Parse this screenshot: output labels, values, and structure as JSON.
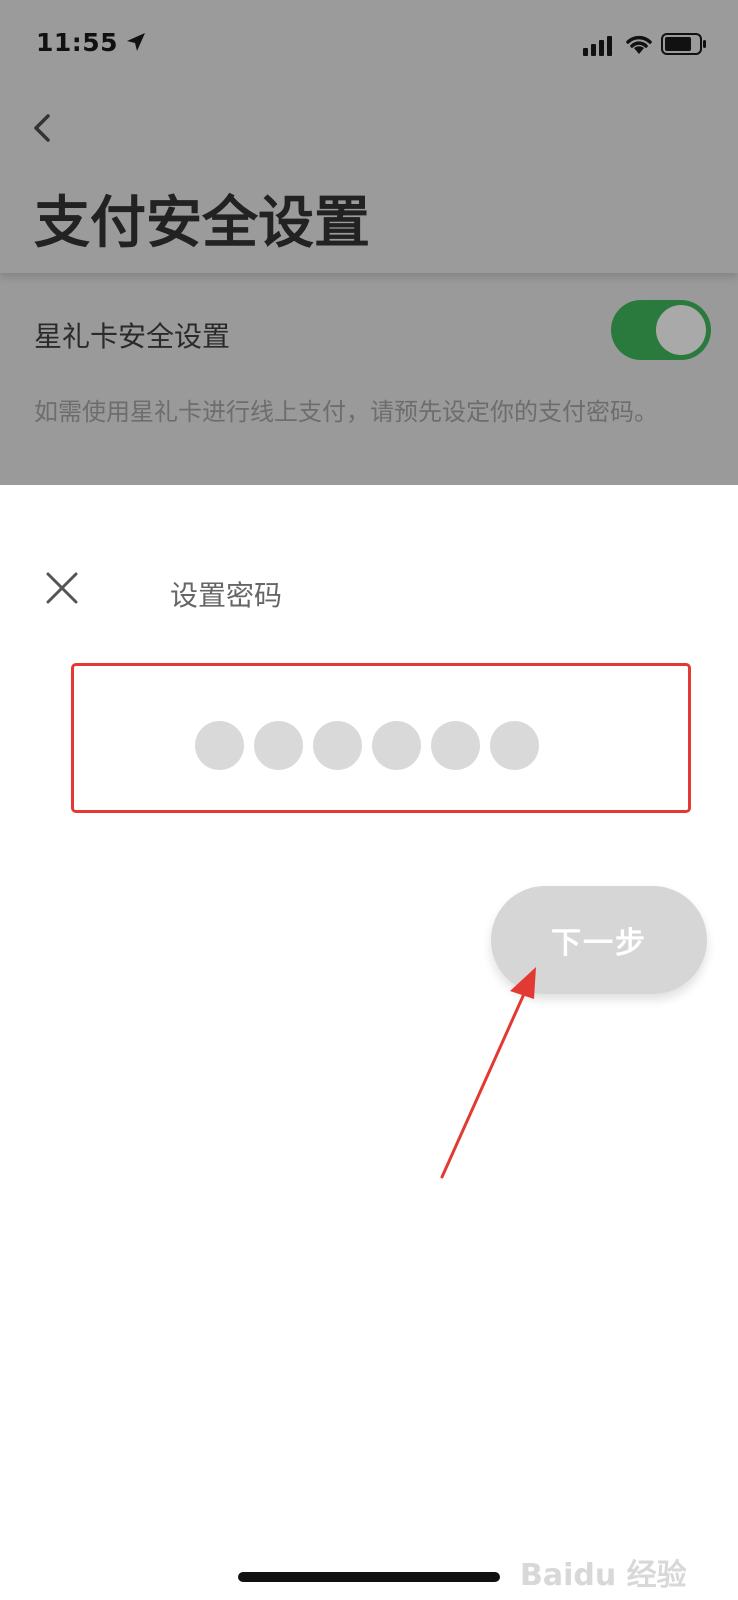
{
  "status_bar": {
    "time": "11:55",
    "icons": [
      "location-arrow-icon",
      "signal-icon",
      "wifi-icon",
      "battery-icon"
    ]
  },
  "header": {
    "back_icon": "chevron-left-icon",
    "title": "支付安全设置"
  },
  "settings": {
    "star_card": {
      "label": "星礼卡安全设置",
      "enabled": true,
      "toggle_color": "#2a7a3d",
      "description": "如需使用星礼卡进行线上支付，请预先设定你的支付密码。"
    }
  },
  "sheet": {
    "close_icon": "close-icon",
    "title": "设置密码",
    "pin_length": 6,
    "highlight_color": "#e23a33",
    "next_label": "下一步"
  },
  "annotation": {
    "arrow_color": "#e23a33"
  },
  "watermark": "Baidu 经验"
}
